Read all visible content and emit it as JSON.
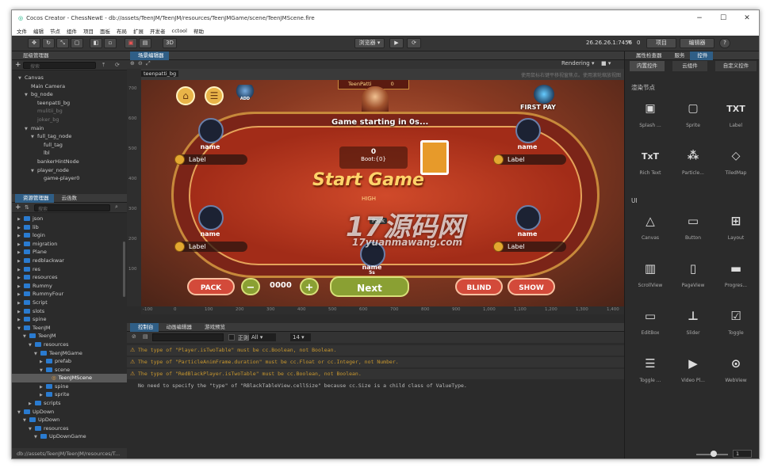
{
  "window": {
    "title": "Cocos Creator - ChessNewE - db://assets/TeenJM/TeenJM/resources/TeenJMGame/scene/TeenJMScene.fire"
  },
  "menu": [
    "文件",
    "编辑",
    "节点",
    "组件",
    "项目",
    "面板",
    "布局",
    "扩展",
    "开发者",
    "cctool",
    "帮助"
  ],
  "toolbar": {
    "mode_3d": "3D",
    "platform": "浏览器",
    "ip": "26.26.26.1:7456",
    "wifi_count": "0",
    "project_btn": "项目",
    "editor_btn": "编辑器",
    "help": "?"
  },
  "hierarchy": {
    "title": "层级管理器",
    "search_placeholder": "搜索",
    "items": [
      {
        "label": "Canvas",
        "indent": 1,
        "expanded": true
      },
      {
        "label": "Main Camera",
        "indent": 2
      },
      {
        "label": "bg_node",
        "indent": 2,
        "expanded": true
      },
      {
        "label": "teenpatti_bg",
        "indent": 3
      },
      {
        "label": "mulitii_bg",
        "indent": 3,
        "dim": true
      },
      {
        "label": "joker_bg",
        "indent": 3,
        "dim": true
      },
      {
        "label": "main",
        "indent": 2,
        "expanded": true
      },
      {
        "label": "full_tag_node",
        "indent": 3,
        "expanded": true
      },
      {
        "label": "full_tag",
        "indent": 4
      },
      {
        "label": "lbl",
        "indent": 4
      },
      {
        "label": "bankerHintNode",
        "indent": 3
      },
      {
        "label": "player_node",
        "indent": 3,
        "expanded": true
      },
      {
        "label": "game-player0",
        "indent": 4
      }
    ]
  },
  "assets": {
    "tabs": [
      "资源管理器",
      "云函数"
    ],
    "search_placeholder": "搜索",
    "items": [
      {
        "label": "json",
        "indent": 1
      },
      {
        "label": "lib",
        "indent": 1
      },
      {
        "label": "login",
        "indent": 1
      },
      {
        "label": "migration",
        "indent": 1
      },
      {
        "label": "Plane",
        "indent": 1
      },
      {
        "label": "redblackwar",
        "indent": 1
      },
      {
        "label": "res",
        "indent": 1
      },
      {
        "label": "resources",
        "indent": 1
      },
      {
        "label": "Rummy",
        "indent": 1
      },
      {
        "label": "RummyFour",
        "indent": 1
      },
      {
        "label": "Script",
        "indent": 1
      },
      {
        "label": "slots",
        "indent": 1
      },
      {
        "label": "spine",
        "indent": 1
      },
      {
        "label": "TeenJM",
        "indent": 1,
        "expanded": true
      },
      {
        "label": "TeenJM",
        "indent": 2,
        "expanded": true
      },
      {
        "label": "resources",
        "indent": 3,
        "expanded": true
      },
      {
        "label": "TeenJMGame",
        "indent": 4,
        "expanded": true
      },
      {
        "label": "prefab",
        "indent": 5
      },
      {
        "label": "scene",
        "indent": 5,
        "expanded": true
      },
      {
        "label": "TeenJMScene",
        "indent": 6,
        "selected": true,
        "file": true
      },
      {
        "label": "spine",
        "indent": 5
      },
      {
        "label": "sprite",
        "indent": 5
      },
      {
        "label": "scripts",
        "indent": 3
      },
      {
        "label": "UpDown",
        "indent": 1,
        "expanded": true
      },
      {
        "label": "UpDown",
        "indent": 2,
        "expanded": true
      },
      {
        "label": "resources",
        "indent": 3,
        "expanded": true
      },
      {
        "label": "UpDownGame",
        "indent": 4,
        "expanded": true
      }
    ],
    "status_path": "db://assets/TeenJM/TeenJM/resources/T..."
  },
  "scene_editor": {
    "tab": "场景编辑器",
    "hint": "使用鼠标右键平移视窗焦点。使用滚轮缩放视图",
    "rendering": "Rendering",
    "node_name": "teenpatti_bg",
    "ruler_v": [
      "700",
      "600",
      "500",
      "400",
      "300",
      "200",
      "100"
    ],
    "ruler_h": [
      "-100",
      "0",
      "100",
      "200",
      "300",
      "400",
      "500",
      "600",
      "700",
      "800",
      "900",
      "1,000",
      "1,100",
      "1,200",
      "1,300",
      "1,400"
    ]
  },
  "game": {
    "top_label": "TeenPatti",
    "top_value": "0",
    "first_pay": "FIRST PAY",
    "add_cash": "ADD CASH",
    "countdown": "Game starting in 0s...",
    "pot": "0",
    "boot": "Boot:{0}",
    "banner": "Start Game",
    "high": "HIGH",
    "pack_chip": "Pack",
    "seat_name": "name",
    "seat_label": "Label",
    "bottom_name": "name",
    "bottom_sub": "5s",
    "btn_pack": "PACK",
    "btn_minus": "−",
    "amount": "0000",
    "btn_plus": "+",
    "btn_next": "Next",
    "btn_blind": "BLIND",
    "btn_show": "SHOW",
    "watermark_cn": "17源码网",
    "watermark_en": "17yuanmawang.com"
  },
  "console": {
    "tabs": [
      "控制台",
      "动画编辑器",
      "游戏预览"
    ],
    "regex": "正则",
    "filter": "All",
    "font_size": "14",
    "logs": [
      {
        "type": "warn",
        "text": "The type of \"Player.isTwoTable\" must be cc.Boolean, not Boolean."
      },
      {
        "type": "warn",
        "text": "The type of \"ParticleAnimFrame.duration\" must be cc.Float or cc.Integer, not Number."
      },
      {
        "type": "warn",
        "text": "The type of \"RedBlackPlayer.isTwoTable\" must be cc.Boolean, not Boolean."
      },
      {
        "type": "info",
        "text": "No need to specify the \"type\" of \"RBlackTableView.cellSize\" because cc.Size is a child class of ValueType."
      }
    ]
  },
  "inspector": {
    "tabs": [
      "属性检查器",
      "服务",
      "控件"
    ],
    "categories": [
      "内置控件",
      "云组件",
      "自定义控件"
    ],
    "render_title": "渲染节点",
    "ui_title": "UI",
    "render_widgets": [
      "Splash ...",
      "Sprite",
      "Label",
      "Rich Text",
      "Particle...",
      "TiledMap"
    ],
    "ui_widgets": [
      "Canvas",
      "Button",
      "Layout",
      "ScrollView",
      "PageView",
      "Progres...",
      "EditBox",
      "Slider",
      "Toggle",
      "Toggle ...",
      "Video Pl...",
      "WebView"
    ],
    "zoom_value": "1"
  },
  "colors": {
    "accent": "#2f5e86",
    "warn": "#c8972e",
    "bg": "#2b2b2b"
  }
}
